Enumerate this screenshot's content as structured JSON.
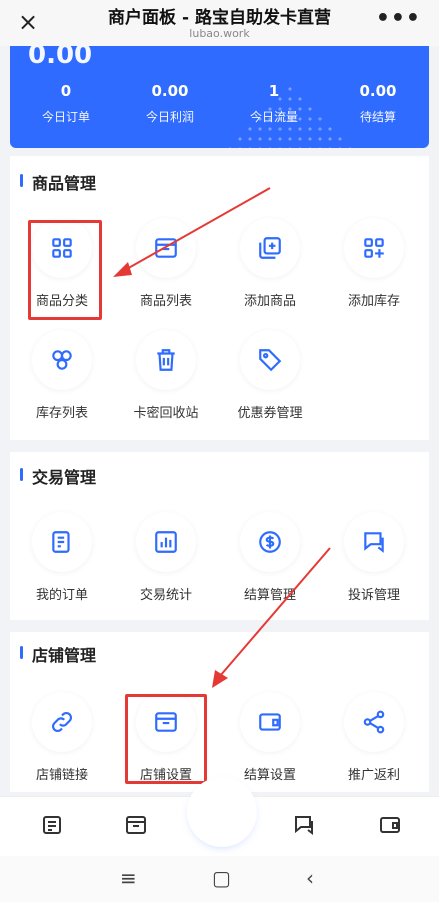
{
  "topbar": {
    "close": "×",
    "title": "商户面板 - 路宝自助发卡直营",
    "subtitle": "lubao.work",
    "more": "•••"
  },
  "stats": {
    "cut_value": "0.00",
    "items": [
      {
        "value": "0",
        "label": "今日订单"
      },
      {
        "value": "0.00",
        "label": "今日利润"
      },
      {
        "value": "1",
        "label": "今日流量"
      },
      {
        "value": "0.00",
        "label": "待结算"
      }
    ]
  },
  "sections": [
    {
      "title": "商品管理",
      "items": [
        {
          "label": "商品分类",
          "icon": "grid-icon"
        },
        {
          "label": "商品列表",
          "icon": "box-icon"
        },
        {
          "label": "添加商品",
          "icon": "add-copy-icon"
        },
        {
          "label": "添加库存",
          "icon": "grid-plus-icon"
        },
        {
          "label": "库存列表",
          "icon": "cubes-icon"
        },
        {
          "label": "卡密回收站",
          "icon": "trash-icon"
        },
        {
          "label": "优惠券管理",
          "icon": "tag-icon"
        }
      ]
    },
    {
      "title": "交易管理",
      "items": [
        {
          "label": "我的订单",
          "icon": "order-icon"
        },
        {
          "label": "交易统计",
          "icon": "bar-chart-icon"
        },
        {
          "label": "结算管理",
          "icon": "dollar-icon"
        },
        {
          "label": "投诉管理",
          "icon": "chat-icon"
        }
      ]
    },
    {
      "title": "店铺管理",
      "items": [
        {
          "label": "店铺链接",
          "icon": "link-icon"
        },
        {
          "label": "店铺设置",
          "icon": "store-icon"
        },
        {
          "label": "结算设置",
          "icon": "wallet-icon"
        },
        {
          "label": "推广返利",
          "icon": "share-icon"
        }
      ]
    }
  ],
  "colors": {
    "accent": "#2f6bff",
    "highlight": "#e53935"
  },
  "sysnav": {
    "menu": "≡",
    "home": "▢",
    "back": "‹"
  }
}
